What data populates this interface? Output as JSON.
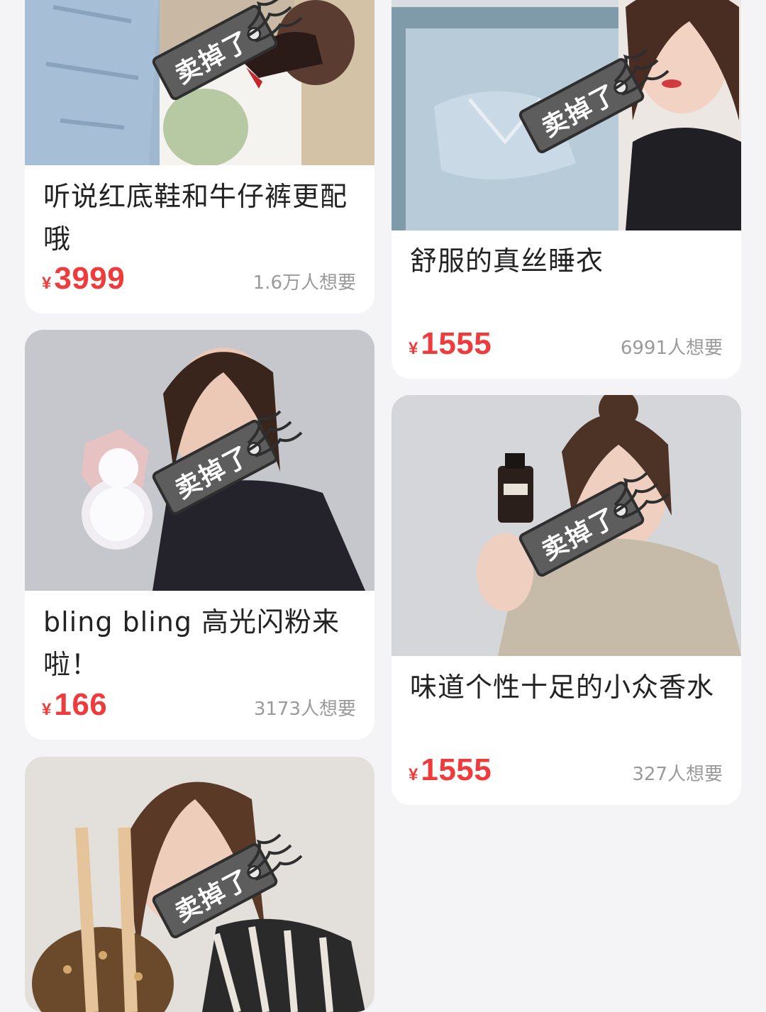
{
  "products": [
    {
      "title": "听说红底鞋和牛仔裤更配哦",
      "currency": "¥",
      "price": "3999",
      "wants": "1.6万人想要",
      "sold_tag": "卖掉了"
    },
    {
      "title": "舒服的真丝睡衣",
      "currency": "¥",
      "price": "1555",
      "wants": "6991人想要",
      "sold_tag": "卖掉了"
    },
    {
      "title": "bling bling 高光闪粉来啦！",
      "currency": "¥",
      "price": "166",
      "wants": "3173人想要",
      "sold_tag": "卖掉了"
    },
    {
      "title": "味道个性十足的小众香水",
      "currency": "¥",
      "price": "1555",
      "wants": "327人想要",
      "sold_tag": "卖掉了"
    },
    {
      "sold_tag": "卖掉了"
    }
  ],
  "colors": {
    "price": "#ef3b3b",
    "wants": "#9a9a9a",
    "background": "#f4f4f6",
    "tag": "#5d5d5d"
  }
}
